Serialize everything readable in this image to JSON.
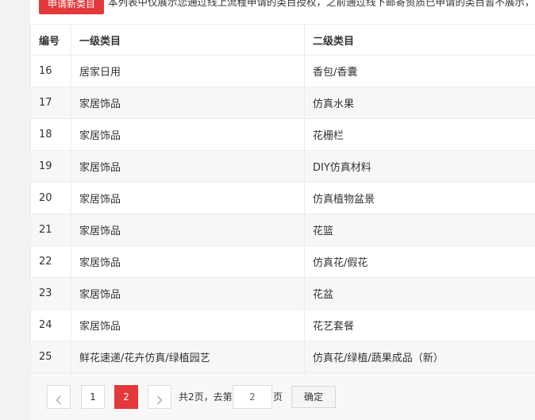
{
  "toolbar": {
    "apply_label": "申请新类目",
    "notice": "本列表中仅展示您通过线上流程申请的类目授权，之前通过线下邮寄资质已申请的类目暂不展示，但不"
  },
  "table": {
    "headers": [
      "编号",
      "一级类目",
      "二级类目"
    ],
    "rows": [
      [
        "16",
        "居家日用",
        "香包/香囊"
      ],
      [
        "17",
        "家居饰品",
        "仿真水果"
      ],
      [
        "18",
        "家居饰品",
        "花栅栏"
      ],
      [
        "19",
        "家居饰品",
        "DIY仿真材料"
      ],
      [
        "20",
        "家居饰品",
        "仿真植物盆景"
      ],
      [
        "21",
        "家居饰品",
        "花篮"
      ],
      [
        "22",
        "家居饰品",
        "仿真花/假花"
      ],
      [
        "23",
        "家居饰品",
        "花盆"
      ],
      [
        "24",
        "家居饰品",
        "花艺套餐"
      ],
      [
        "25",
        "鲜花速递/花卉仿真/绿植园艺",
        "仿真花/绿植/蔬果成品（新）"
      ]
    ]
  },
  "pagination": {
    "prev_icon": "chevron-left-icon",
    "next_icon": "chevron-right-icon",
    "pages": [
      "1",
      "2"
    ],
    "current_page": "2",
    "total_text": "共2页，去第",
    "page_suffix": "页",
    "goto_value": "2",
    "confirm_label": "确定"
  },
  "colors": {
    "accent": "#e4393c",
    "row_alt": "#f7f7f7",
    "border": "#ececec",
    "page_bg": "#f2f2f2"
  }
}
